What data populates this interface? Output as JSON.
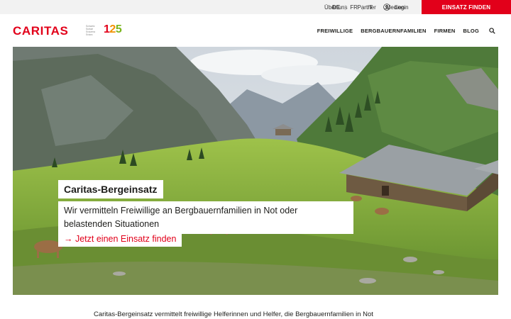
{
  "topbar": {
    "links": [
      "Über uns",
      "Partner",
      "Medien"
    ],
    "languages": [
      "DE",
      "FR",
      "IT"
    ],
    "active_language": "DE",
    "login_label": "Login",
    "cta_label": "EINSATZ FINDEN"
  },
  "header": {
    "logo_text": "CARITAS",
    "logo_sub": [
      "Schweiz",
      "Suisse",
      "Svizzera",
      "Svizra"
    ],
    "anniversary": "125",
    "nav": [
      "FREIWILLIGE",
      "BERGBAUERNFAMILIEN",
      "FIRMEN",
      "BLOG"
    ]
  },
  "hero": {
    "title": "Caritas-Bergeinsatz",
    "text": "Wir vermitteln Freiwillige an Bergbauernfamilien in Not oder belastenden Situationen",
    "link_label": "Jetzt einen Einsatz finden"
  },
  "intro": "Caritas-Bergeinsatz vermittelt freiwillige Helferinnen und Helfer, die Bergbauernfamilien in Not",
  "colors": {
    "brand": "#e2001a",
    "topbar": "#f2f2f2"
  }
}
